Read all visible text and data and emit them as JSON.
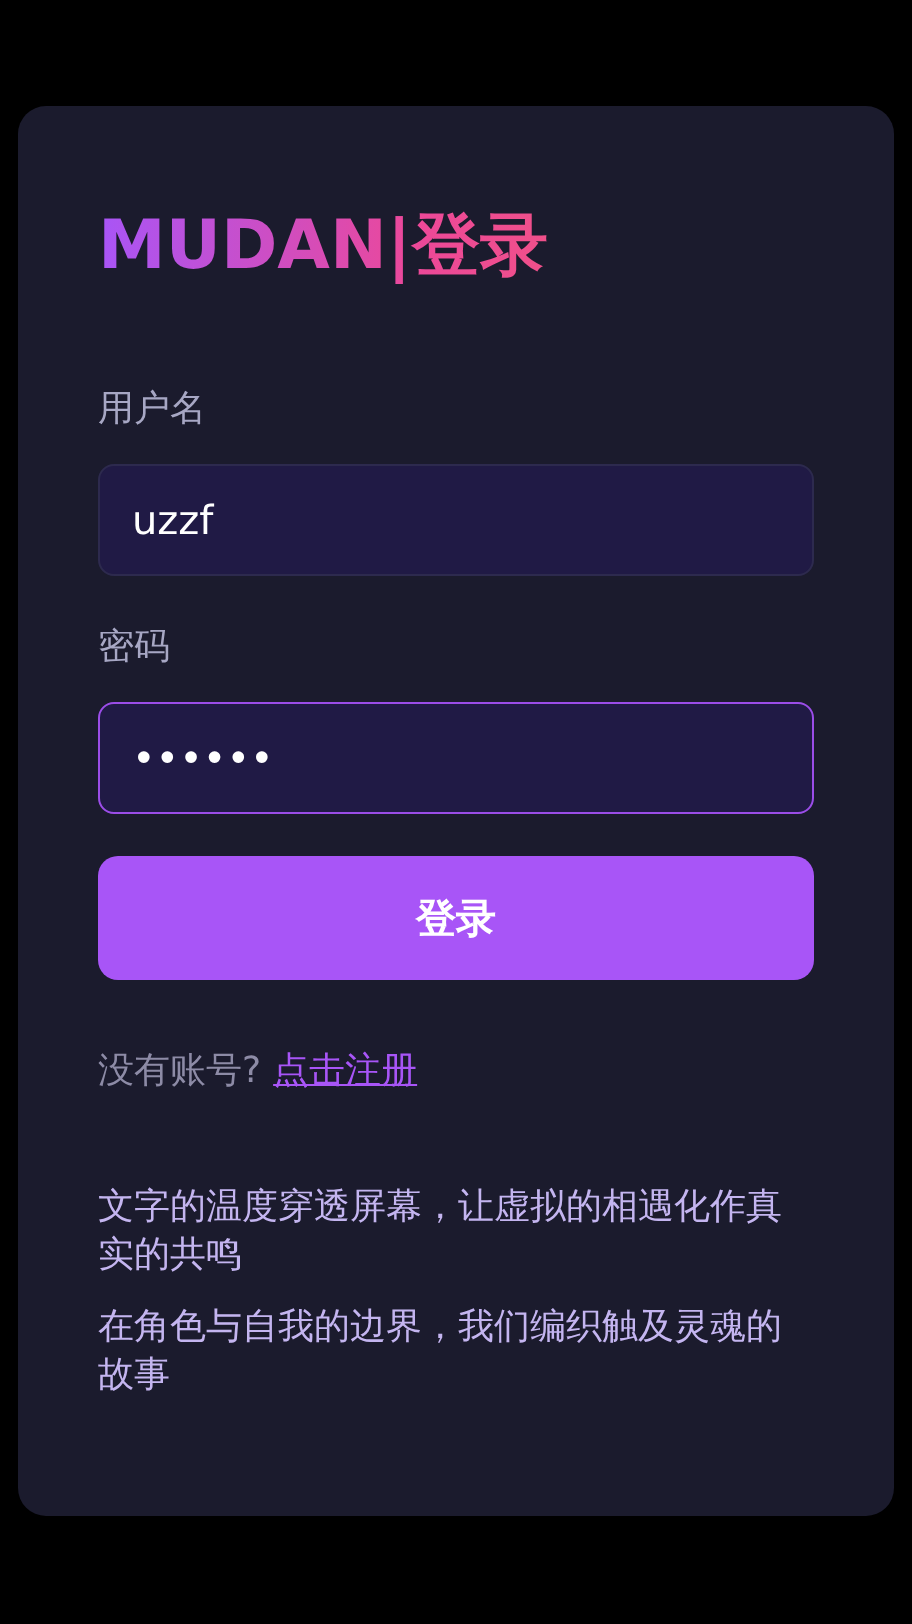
{
  "title": "MUDAN|登录",
  "fields": [
    {
      "label": "用户名",
      "value": "uzzf",
      "focused": false
    },
    {
      "label": "密码",
      "value": "••••••",
      "focused": true
    }
  ],
  "submit": "登录",
  "signup": {
    "prompt": "没有账号?",
    "link": "点击注册"
  },
  "taglines": [
    "文字的温度穿透屏幕，让虚拟的相遇化作真实的共鸣",
    "在角色与自我的边界，我们编织触及灵魂的故事"
  ]
}
